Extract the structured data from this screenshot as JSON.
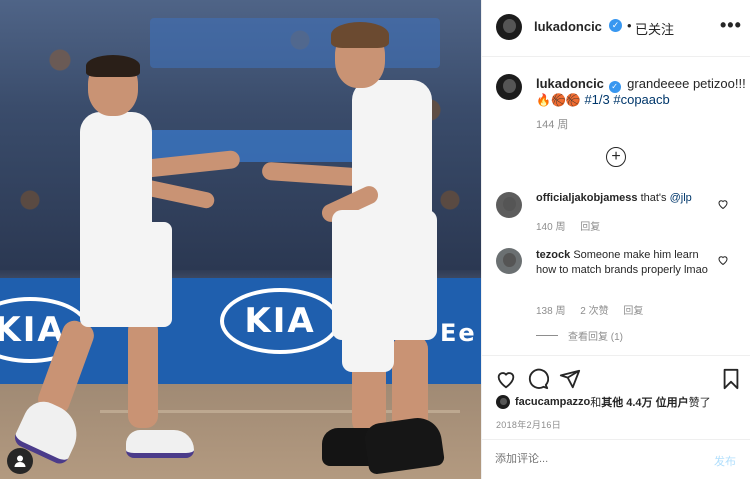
{
  "post": {
    "photo_alt": "",
    "ad_brand": "KIA",
    "ad_brand_partial": "Ee"
  },
  "header": {
    "username": "lukadoncic",
    "verified_icon": "verified-badge-icon",
    "separator": "•",
    "follow_status": "已关注",
    "more_label": "•••"
  },
  "caption": {
    "username": "lukadoncic",
    "text": "grandeeee petizoo!!!",
    "emoji_line": "🔥🏀🏀",
    "hashtags": "#1/3 #copaacb",
    "time": "144 周"
  },
  "load_more_icon": "plus-circle-icon",
  "comments": [
    {
      "username": "officialjakobjamess",
      "text": "that's ",
      "mention": "@jlp",
      "time": "140 周",
      "reply_label": "回复"
    },
    {
      "username": "tezock",
      "text": "Someone make him learn how to match brands properly lmao",
      "time": "138 周",
      "likes": "2 次赞",
      "reply_label": "回复",
      "view_replies": "查看回复 (1)"
    }
  ],
  "likes": {
    "liker": "facucampazzo",
    "text_mid": " 和 ",
    "text_others": "其他 4.4万 位用户",
    "text_end": " 赞了"
  },
  "post_date": "2018年2月16日",
  "add_comment": {
    "placeholder": "添加评论...",
    "post_label": "发布"
  },
  "colors": {
    "link": "#00376b",
    "verified": "#3897f0",
    "muted": "#8e8e8e",
    "post_disabled": "#b2dffc"
  }
}
